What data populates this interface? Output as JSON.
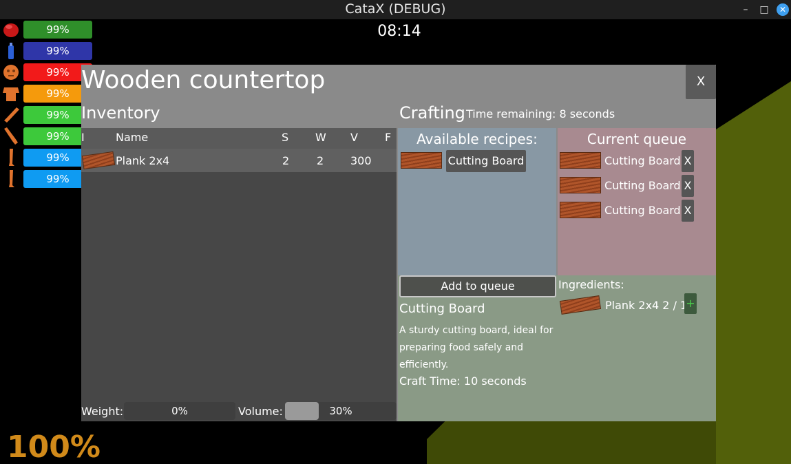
{
  "window": {
    "title": "CataX (DEBUG)",
    "minimize": "–",
    "maximize": "□",
    "close": "✕"
  },
  "hud": {
    "clock": "08:14",
    "big_percent": "100%",
    "status": [
      {
        "icon": "stomach-icon",
        "value": "99%",
        "color": "#2f8f2a"
      },
      {
        "icon": "water-bottle-icon",
        "value": "99%",
        "color": "#2f36a8"
      },
      {
        "icon": "head-icon",
        "value": "99%",
        "color": "#f21a1a"
      },
      {
        "icon": "torso-icon",
        "value": "99%",
        "color": "#f59a0c"
      },
      {
        "icon": "left-arm-icon",
        "value": "99%",
        "color": "#3dc93b"
      },
      {
        "icon": "right-arm-icon",
        "value": "99%",
        "color": "#3dc93b"
      },
      {
        "icon": "left-leg-icon",
        "value": "99%",
        "color": "#0f9bf2"
      },
      {
        "icon": "right-leg-icon",
        "value": "99%",
        "color": "#0f9bf2"
      }
    ]
  },
  "panel": {
    "title": "Wooden countertop",
    "close": "X",
    "inventory": {
      "title": "Inventory",
      "headers": {
        "icon": "I",
        "name": "Name",
        "s": "S",
        "w": "W",
        "v": "V",
        "f": "F"
      },
      "items": [
        {
          "name": "Plank 2x4",
          "s": "2",
          "w": "2",
          "v": "300",
          "f": ""
        }
      ],
      "weight_label": "Weight:",
      "weight_value": "0%",
      "weight_fraction": 0.0,
      "volume_label": "Volume:",
      "volume_value": "30%",
      "volume_fraction": 0.3
    },
    "crafting": {
      "title": "Crafting",
      "time_remaining": "Time remaining: 8 seconds",
      "recipes_title": "Available recipes:",
      "recipes": [
        "Cutting Board"
      ],
      "queue_title": "Current queue",
      "queue": [
        "Cutting Board",
        "Cutting Board",
        "Cutting Board"
      ],
      "queue_remove": "X",
      "add_to_queue": "Add to queue",
      "selected_name": "Cutting Board",
      "selected_description": "A sturdy cutting board, ideal for preparing food safely and efficiently.",
      "craft_time": "Craft Time: 10 seconds",
      "ingredients_title": "Ingredients:",
      "ingredients": [
        {
          "label": "Plank 2x4 2 / 1",
          "add": "+"
        }
      ]
    }
  }
}
